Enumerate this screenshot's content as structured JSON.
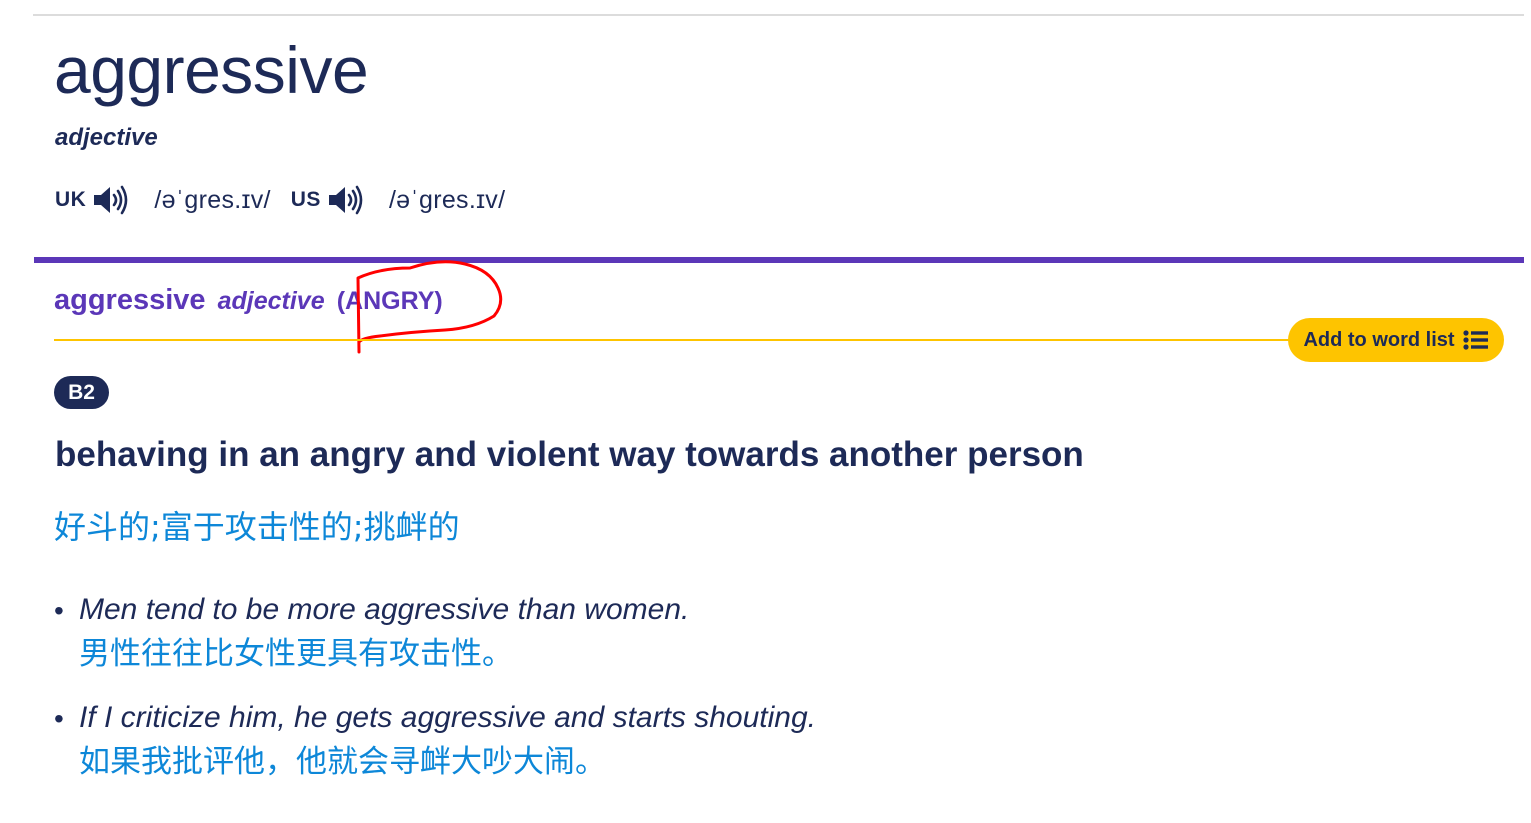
{
  "entry": {
    "headword": "aggressive",
    "part_of_speech": "adjective",
    "pronunciations": [
      {
        "region": "UK",
        "audio_icon": "speaker-icon",
        "ipa": "/əˈgres.ɪv/"
      },
      {
        "region": "US",
        "audio_icon": "speaker-icon",
        "ipa": "/əˈgres.ɪv/"
      }
    ]
  },
  "sense": {
    "headword": "aggressive",
    "part_of_speech": "adjective",
    "guideword": "(ANGRY)",
    "add_to_word_list_label": "Add to word list",
    "add_to_word_list_icon": "list-icon",
    "level": "B2",
    "definition": "behaving in an angry and violent way towards another person",
    "definition_translation": "好斗的;富于攻击性的;挑衅的",
    "examples": [
      {
        "text": "Men tend to be more aggressive than women.",
        "translation": "男性往往比女性更具有攻击性。"
      },
      {
        "text": "If I criticize him, he gets aggressive and starts shouting.",
        "translation": "如果我批评他，他就会寻衅大吵大闹。"
      }
    ]
  },
  "annotation": {
    "type": "red-freehand-circle",
    "target": "guideword",
    "color": "#ff0000"
  },
  "colors": {
    "text_dark": "#1d2a57",
    "accent_purple": "#5b37b8",
    "accent_yellow": "#fec400",
    "translation_blue": "#0d87d8",
    "divider_gray": "#dcdcdc"
  }
}
